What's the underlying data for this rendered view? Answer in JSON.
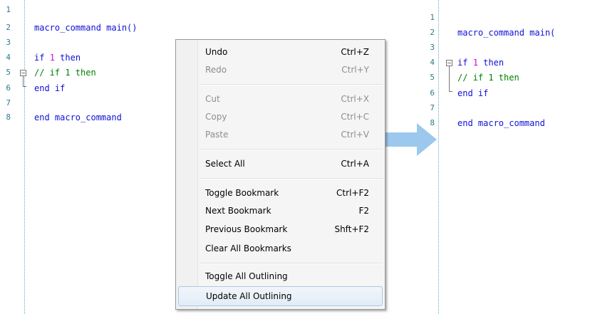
{
  "left_editor": {
    "lines": [
      {
        "n": "1",
        "text": ""
      },
      {
        "n": "2",
        "text": "macro_command main()"
      },
      {
        "n": "3",
        "text": ""
      },
      {
        "n": "4",
        "kw": "if ",
        "num": "1",
        "kw2": " then"
      },
      {
        "n": "5",
        "cm": "// if 1 then"
      },
      {
        "n": "6",
        "text": "end if"
      },
      {
        "n": "7",
        "text": ""
      },
      {
        "n": "8",
        "text": "end macro_command"
      }
    ]
  },
  "right_editor": {
    "lines": [
      {
        "n": "1",
        "text": ""
      },
      {
        "n": "2",
        "text": "macro_command main("
      },
      {
        "n": "3",
        "text": ""
      },
      {
        "n": "4",
        "kw": "if ",
        "num": "1",
        "kw2": " then"
      },
      {
        "n": "5",
        "cm": "// if 1 then"
      },
      {
        "n": "6",
        "text": "end if"
      },
      {
        "n": "7",
        "text": ""
      },
      {
        "n": "8",
        "text": "end macro_command"
      }
    ]
  },
  "context_menu": {
    "items": [
      {
        "label": "Undo",
        "shortcut": "Ctrl+Z",
        "enabled": true
      },
      {
        "label": "Redo",
        "shortcut": "Ctrl+Y",
        "enabled": false
      },
      {
        "label": "Cut",
        "shortcut": "Ctrl+X",
        "enabled": false
      },
      {
        "label": "Copy",
        "shortcut": "Ctrl+C",
        "enabled": false
      },
      {
        "label": "Paste",
        "shortcut": "Ctrl+V",
        "enabled": false
      },
      {
        "label": "Select All",
        "shortcut": "Ctrl+A",
        "enabled": true
      },
      {
        "label": "Toggle Bookmark",
        "shortcut": "Ctrl+F2",
        "enabled": true
      },
      {
        "label": "Next Bookmark",
        "shortcut": "F2",
        "enabled": true
      },
      {
        "label": "Previous Bookmark",
        "shortcut": "Shft+F2",
        "enabled": true
      },
      {
        "label": "Clear All Bookmarks",
        "shortcut": "",
        "enabled": true
      },
      {
        "label": "Toggle All Outlining",
        "shortcut": "",
        "enabled": true
      },
      {
        "label": "Update All Outlining",
        "shortcut": "",
        "enabled": true,
        "highlighted": true
      }
    ]
  },
  "colors": {
    "keyword": "#1010d8",
    "number": "#e000e0",
    "comment": "#008000",
    "line_number": "#2b7c8a",
    "arrow": "#9cc8ee"
  }
}
